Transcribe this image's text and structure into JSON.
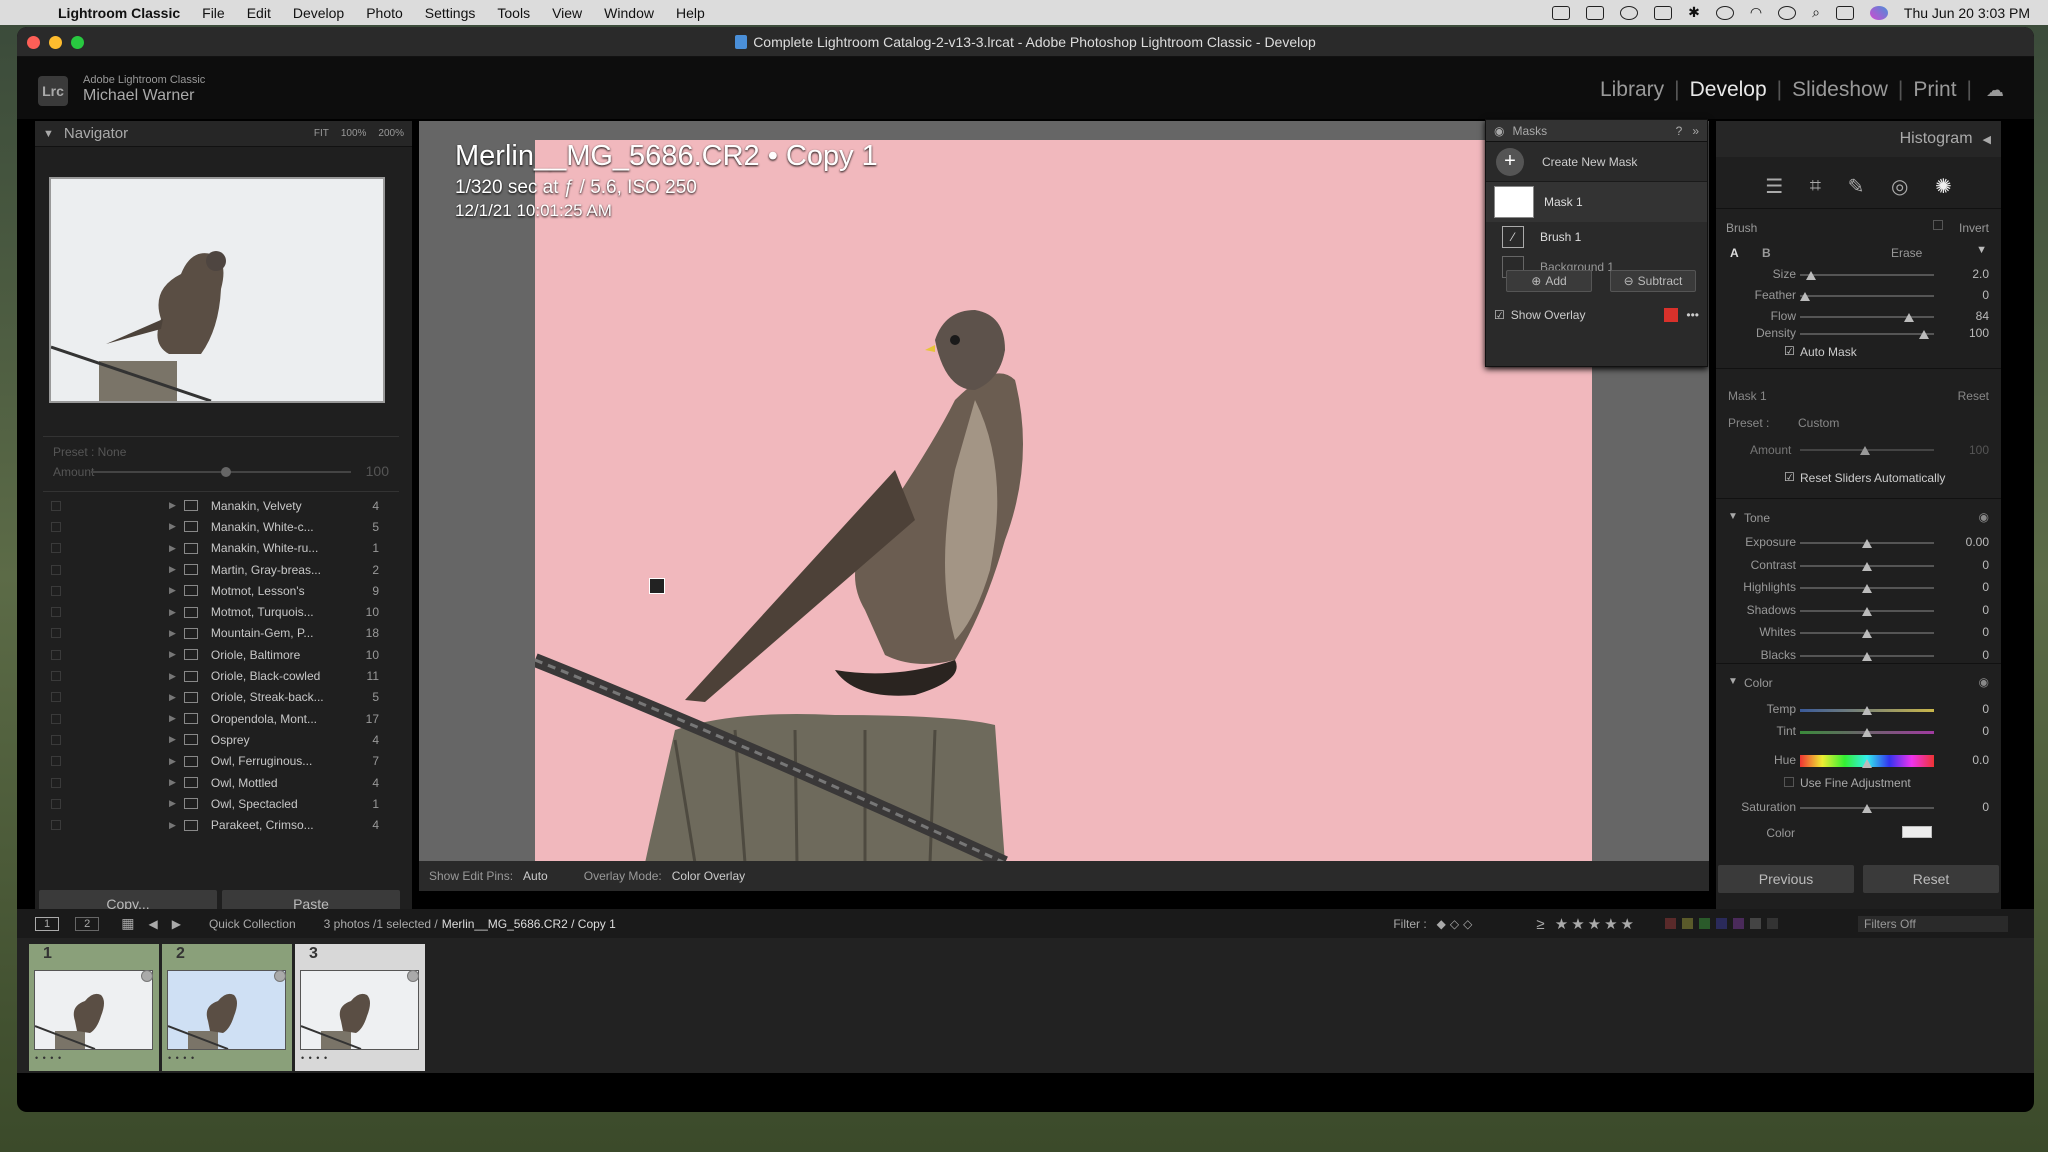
{
  "menubar": {
    "app": "Lightroom Classic",
    "items": [
      "File",
      "Edit",
      "Develop",
      "Photo",
      "Settings",
      "Tools",
      "View",
      "Window",
      "Help"
    ],
    "clock": "Thu Jun 20  3:03 PM"
  },
  "window": {
    "title": "Complete Lightroom Catalog-2-v13-3.lrcat - Adobe Photoshop Lightroom Classic - Develop"
  },
  "identity": {
    "badge": "Lrc",
    "product": "Adobe Lightroom Classic",
    "user": "Michael Warner"
  },
  "modules": {
    "items": [
      "Library",
      "Develop",
      "Slideshow",
      "Print"
    ],
    "active": "Develop"
  },
  "navigator": {
    "title": "Navigator",
    "zoom": [
      "FIT",
      "100%",
      "200%"
    ]
  },
  "preset_box": {
    "label": "Preset : None",
    "amount_label": "Amount",
    "amount_value": "100",
    "amount_level": 0.5
  },
  "collections": [
    {
      "name": "Manakin, Velvety",
      "count": "4"
    },
    {
      "name": "Manakin, White-c...",
      "count": "5"
    },
    {
      "name": "Manakin, White-ru...",
      "count": "1"
    },
    {
      "name": "Martin, Gray-breas...",
      "count": "2"
    },
    {
      "name": "Motmot, Lesson's",
      "count": "9"
    },
    {
      "name": "Motmot, Turquois...",
      "count": "10"
    },
    {
      "name": "Mountain-Gem, P...",
      "count": "18"
    },
    {
      "name": "Oriole, Baltimore",
      "count": "10"
    },
    {
      "name": "Oriole, Black-cowled",
      "count": "11"
    },
    {
      "name": "Oriole, Streak-back...",
      "count": "5"
    },
    {
      "name": "Oropendola, Mont...",
      "count": "17"
    },
    {
      "name": "Osprey",
      "count": "4"
    },
    {
      "name": "Owl, Ferruginous...",
      "count": "7"
    },
    {
      "name": "Owl, Mottled",
      "count": "4"
    },
    {
      "name": "Owl, Spectacled",
      "count": "1"
    },
    {
      "name": "Parakeet, Crimso...",
      "count": "4"
    }
  ],
  "left_buttons": {
    "copy": "Copy...",
    "paste": "Paste"
  },
  "photo_info": {
    "filename": "Merlin__MG_5686.CR2  •  Copy 1",
    "exposure": "1/320 sec at ƒ / 5.6, ISO 250",
    "date": "12/1/21 10:01:25 AM"
  },
  "masks_panel": {
    "title": "Masks",
    "create": "Create New Mask",
    "mask": "Mask 1",
    "components": [
      "Brush 1",
      "Background 1"
    ],
    "add": "Add",
    "subtract": "Subtract",
    "show_overlay": "Show Overlay",
    "overlay_color": "#d9312b"
  },
  "toolbar": {
    "edit_pins_label": "Show Edit Pins:",
    "edit_pins_value": "Auto",
    "overlay_mode_label": "Overlay Mode:",
    "overlay_mode_value": "Color Overlay"
  },
  "right_panel": {
    "histogram": "Histogram",
    "brush": {
      "title": "Brush",
      "invert": "Invert",
      "tabs": [
        "A",
        "B",
        "Erase"
      ],
      "sliders": [
        {
          "label": "Size",
          "value": "2.0",
          "level": 0.05
        },
        {
          "label": "Feather",
          "value": "0",
          "level": 0.0
        },
        {
          "label": "Flow",
          "value": "84",
          "level": 0.84
        },
        {
          "label": "Density",
          "value": "100",
          "level": 0.96
        }
      ],
      "auto_mask": "Auto Mask"
    },
    "mask_settings": {
      "title": "Mask 1",
      "reset": "Reset",
      "preset_label": "Preset :",
      "preset_value": "Custom",
      "amount_label": "Amount",
      "amount_value": "100",
      "reset_sliders": "Reset Sliders Automatically"
    },
    "tone": {
      "title": "Tone",
      "sliders": [
        {
          "label": "Exposure",
          "value": "0.00"
        },
        {
          "label": "Contrast",
          "value": "0"
        },
        {
          "label": "Highlights",
          "value": "0"
        },
        {
          "label": "Shadows",
          "value": "0"
        },
        {
          "label": "Whites",
          "value": "0"
        },
        {
          "label": "Blacks",
          "value": "0"
        }
      ]
    },
    "color": {
      "title": "Color",
      "temp": {
        "label": "Temp",
        "value": "0"
      },
      "tint": {
        "label": "Tint",
        "value": "0"
      },
      "hue": {
        "label": "Hue",
        "value": "0.0"
      },
      "fine": "Use Fine Adjustment",
      "saturation": {
        "label": "Saturation",
        "value": "0"
      },
      "color_label": "Color"
    },
    "previous": "Previous",
    "reset": "Reset"
  },
  "filmstrip_bar": {
    "pages": [
      "1",
      "2"
    ],
    "source": "Quick Collection",
    "status_prefix": "3 photos /1 selected /",
    "status_file": "Merlin__MG_5686.CR2 / Copy 1",
    "filter_label": "Filter :",
    "filters_off": "Filters Off"
  },
  "filmstrip": [
    {
      "num": "1",
      "stars": "• • • •"
    },
    {
      "num": "2",
      "stars": "• • • •"
    },
    {
      "num": "3",
      "stars": "• • • •"
    }
  ]
}
